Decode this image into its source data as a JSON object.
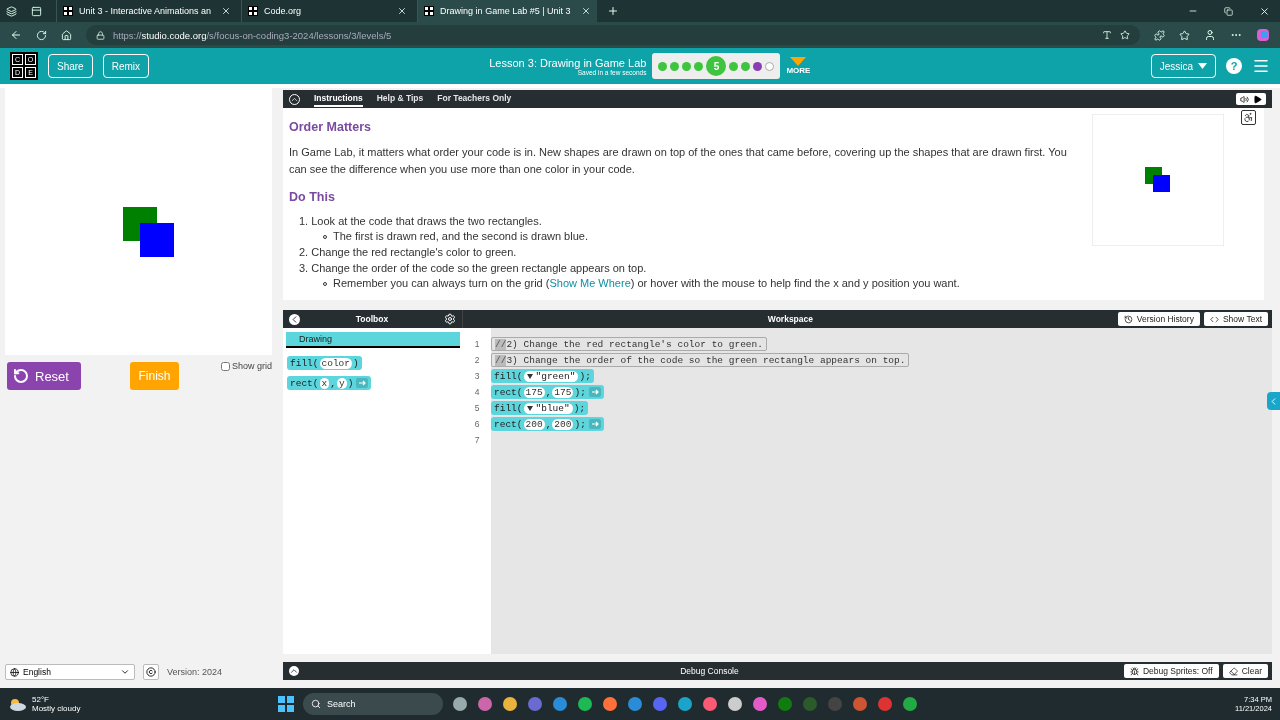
{
  "browser": {
    "tabs": [
      {
        "title": "Unit 3 - Interactive Animations an",
        "selected": false
      },
      {
        "title": "Code.org",
        "selected": false
      },
      {
        "title": "Drawing in Game Lab #5 | Unit 3",
        "selected": true
      }
    ],
    "url": {
      "scheme": "https://",
      "host": "studio.code.org",
      "path": "/s/focus-on-coding3-2024/lessons/3/levels/5"
    }
  },
  "header": {
    "logo_letters": [
      "C",
      "O",
      "D",
      "E"
    ],
    "buttons": [
      "Share",
      "Remix"
    ],
    "lesson_title": "Lesson 3: Drawing in Game Lab",
    "save_status": "Saved in a few seconds",
    "progress": [
      {
        "kind": "done",
        "selected": false
      },
      {
        "kind": "done",
        "selected": false
      },
      {
        "kind": "done",
        "selected": false
      },
      {
        "kind": "done",
        "selected": false
      },
      {
        "kind": "done",
        "selected": true,
        "label": "5"
      },
      {
        "kind": "done",
        "selected": false
      },
      {
        "kind": "done",
        "selected": false
      },
      {
        "kind": "assessment",
        "selected": false
      },
      {
        "kind": "todo",
        "selected": false
      }
    ],
    "more": "MORE",
    "user": "Jessica",
    "help": "?"
  },
  "stage": {
    "reset": "Reset",
    "finish": "Finish",
    "show_grid": {
      "label": "Show grid",
      "checked": false
    },
    "language": "English",
    "version": "Version: 2024"
  },
  "instructions": {
    "tabs": [
      {
        "label": "Instructions",
        "selected": true
      },
      {
        "label": "Help & Tips",
        "selected": false
      },
      {
        "label": "For Teachers Only",
        "selected": false
      }
    ],
    "heading": "Order Matters",
    "paragraph": "In Game Lab, it matters what order your code is in. New shapes are drawn on top of the ones that came before, covering up the shapes that are drawn first. You can see the difference when you use more than one color in your code.",
    "subheading": "Do This",
    "steps": [
      {
        "number": "1.",
        "text": "Look at the code that draws the two rectangles.",
        "notes": [
          {
            "text": "The first is drawn red, and the second is drawn blue."
          }
        ]
      },
      {
        "number": "2.",
        "text": "Change the red rectangle's color to green."
      },
      {
        "number": "3.",
        "text": "Change the order of the code so the green rectangle appears on top.",
        "notes": [
          {
            "text": "Remember you can always turn on the grid (",
            "link": "Show Me Where",
            "after": ") or hover with the mouse to help find the x and y position you want."
          }
        ]
      }
    ]
  },
  "toolbox": {
    "title": "Toolbox",
    "category": "Drawing",
    "blocks": [
      {
        "parts": [
          {
            "kind": "text",
            "text": "fill("
          },
          {
            "kind": "slot",
            "text": "color"
          },
          {
            "kind": "text",
            "text": ")"
          }
        ]
      },
      {
        "parts": [
          {
            "kind": "text",
            "text": "rect("
          },
          {
            "kind": "slot",
            "text": "x"
          },
          {
            "kind": "text",
            "text": ", "
          },
          {
            "kind": "slot",
            "text": "y"
          },
          {
            "kind": "text",
            "text": ")"
          },
          {
            "kind": "arrow"
          }
        ]
      }
    ]
  },
  "workspace": {
    "title": "Workspace",
    "buttons": [
      "Version History",
      "Show Text"
    ],
    "lines": [
      {
        "number": "1",
        "kind": "comment",
        "marker": "//",
        "text": "2) Change the red rectangle's color to green."
      },
      {
        "number": "2",
        "kind": "comment",
        "marker": "//",
        "text": "3) Change the order of the code so the green rectangle appears on top."
      },
      {
        "number": "3",
        "kind": "block",
        "parts": [
          {
            "kind": "text",
            "text": "fill("
          },
          {
            "kind": "dropdown",
            "text": "\"green\""
          },
          {
            "kind": "text",
            "text": ");"
          }
        ]
      },
      {
        "number": "4",
        "kind": "block",
        "parts": [
          {
            "kind": "text",
            "text": "rect("
          },
          {
            "kind": "slot",
            "text": "175"
          },
          {
            "kind": "text",
            "text": ","
          },
          {
            "kind": "slot",
            "text": "175"
          },
          {
            "kind": "text",
            "text": ");"
          },
          {
            "kind": "arrow"
          }
        ]
      },
      {
        "number": "5",
        "kind": "block",
        "parts": [
          {
            "kind": "text",
            "text": "fill("
          },
          {
            "kind": "dropdown",
            "text": "\"blue\""
          },
          {
            "kind": "text",
            "text": ");"
          }
        ]
      },
      {
        "number": "6",
        "kind": "block",
        "parts": [
          {
            "kind": "text",
            "text": "rect("
          },
          {
            "kind": "slot",
            "text": "200"
          },
          {
            "kind": "text",
            "text": ", "
          },
          {
            "kind": "slot",
            "text": "200"
          },
          {
            "kind": "text",
            "text": ");"
          },
          {
            "kind": "arrow"
          }
        ]
      },
      {
        "number": "7",
        "kind": "empty"
      }
    ]
  },
  "debug": {
    "title": "Debug Console",
    "buttons": [
      "Debug Sprites: Off",
      "Clear"
    ]
  },
  "taskbar": {
    "temperature": "52°F",
    "condition": "Mostly cloudy",
    "search": "Search",
    "time": "7:34 PM",
    "date": "11/21/2024"
  }
}
